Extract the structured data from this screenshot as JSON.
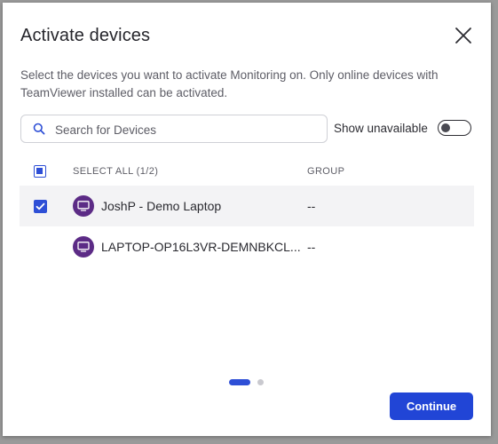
{
  "dialog": {
    "title": "Activate devices",
    "description": "Select the devices you want to activate Monitoring on. Only online devices with TeamViewer installed can be activated."
  },
  "search": {
    "placeholder": "Search for Devices",
    "value": ""
  },
  "show_unavailable": {
    "label": "Show unavailable",
    "enabled": false
  },
  "table": {
    "select_all_label": "SELECT ALL (1/2)",
    "group_header": "GROUP",
    "rows": [
      {
        "name": "JoshP - Demo Laptop",
        "group": "--",
        "checked": true
      },
      {
        "name": "LAPTOP-OP16L3VR-DEMNBKCL...",
        "group": "--",
        "checked": false
      }
    ]
  },
  "pagination": {
    "pages": 2,
    "current": 1
  },
  "footer": {
    "continue_label": "Continue"
  },
  "colors": {
    "accent": "#2145d6",
    "device_avatar": "#5c2b86",
    "selected_row": "#f3f3f5"
  },
  "icons": {
    "close": "close-icon",
    "search": "search-icon",
    "device": "monitor-icon",
    "check": "checkmark-icon"
  }
}
